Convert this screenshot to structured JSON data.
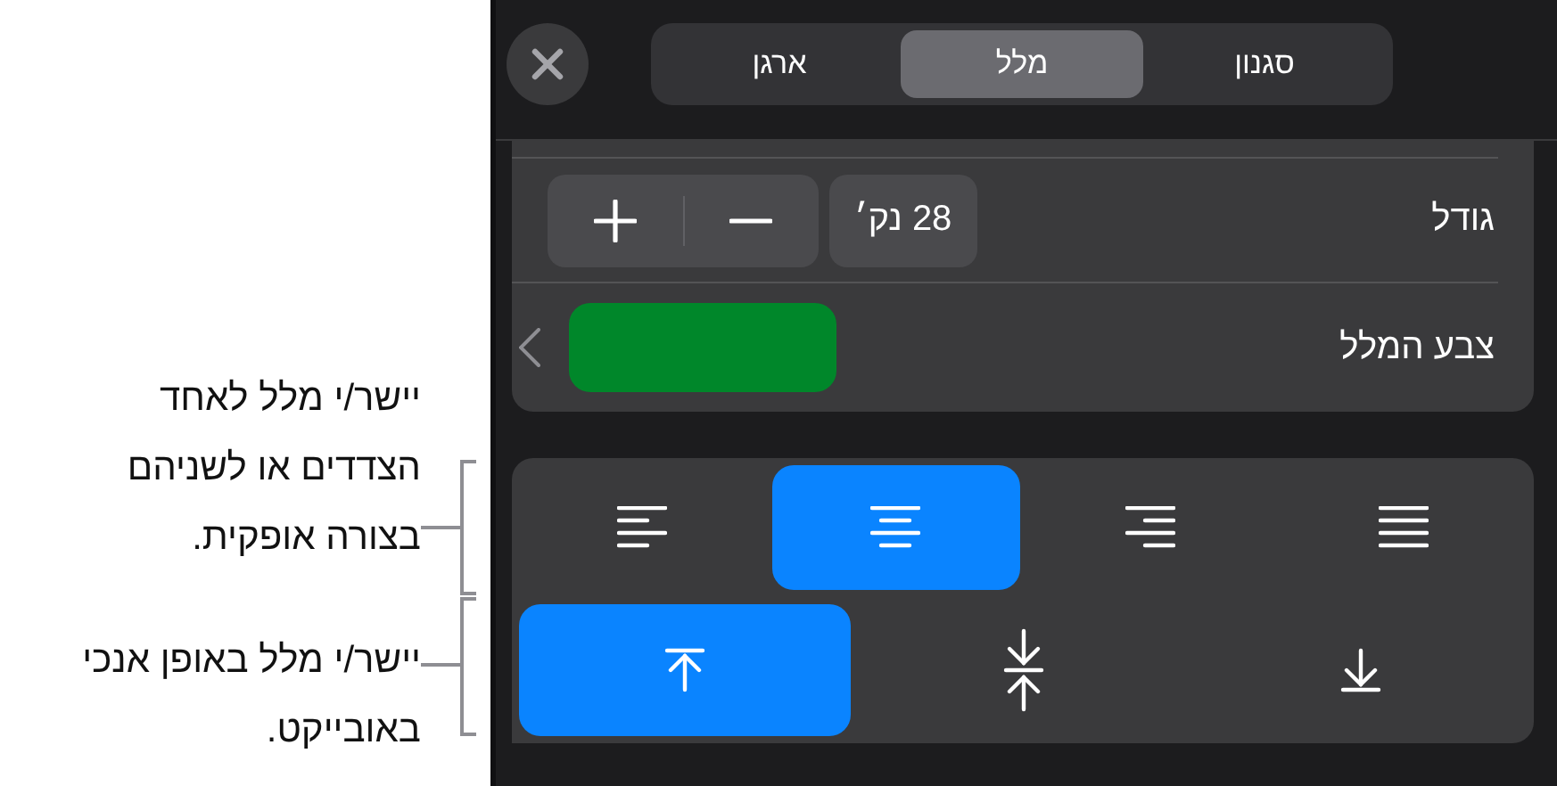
{
  "callouts": [
    {
      "text": "יישר/י מלל לאחד הצדדים או לשניהם בצורה אופקית."
    },
    {
      "text": "יישר/י מלל באופן אנכי באובייקט."
    }
  ],
  "tabs": [
    {
      "label": "סגנון",
      "selected": false
    },
    {
      "label": "מלל",
      "selected": true
    },
    {
      "label": "ארגן",
      "selected": false
    }
  ],
  "size": {
    "label": "גודל",
    "value": "28 נק׳"
  },
  "text_color": {
    "label": "צבע המלל",
    "color": "#00872a"
  },
  "horizontal_alignment": [
    {
      "kind": "left",
      "selected": false
    },
    {
      "kind": "center",
      "selected": true
    },
    {
      "kind": "right",
      "selected": false
    },
    {
      "kind": "justify",
      "selected": false
    }
  ],
  "vertical_alignment": [
    {
      "kind": "top",
      "selected": true
    },
    {
      "kind": "middle",
      "selected": false
    },
    {
      "kind": "bottom",
      "selected": false
    }
  ]
}
